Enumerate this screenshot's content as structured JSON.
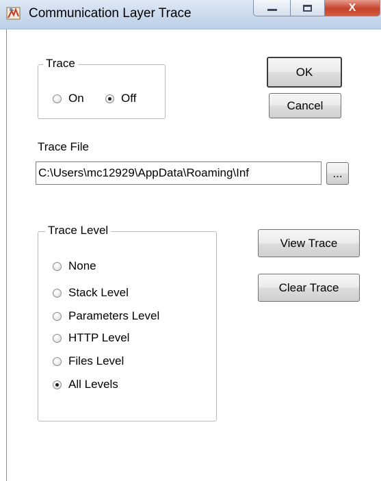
{
  "window": {
    "title": "Communication Layer Trace",
    "close_glyph": "X"
  },
  "trace_group": {
    "label": "Trace",
    "options": [
      {
        "label": "On",
        "checked": false
      },
      {
        "label": "Off",
        "checked": true
      }
    ]
  },
  "buttons": {
    "ok": "OK",
    "cancel": "Cancel",
    "view_trace": "View Trace",
    "clear_trace": "Clear Trace",
    "browse": "..."
  },
  "trace_file": {
    "label": "Trace File",
    "value": "C:\\Users\\mc12929\\AppData\\Roaming\\Inf"
  },
  "trace_level_group": {
    "label": "Trace Level",
    "options": [
      {
        "label": "None",
        "checked": false
      },
      {
        "label": "Stack Level",
        "checked": false
      },
      {
        "label": "Parameters Level",
        "checked": false
      },
      {
        "label": "HTTP Level",
        "checked": false
      },
      {
        "label": "Files Level",
        "checked": false
      },
      {
        "label": "All Levels",
        "checked": true
      }
    ]
  }
}
